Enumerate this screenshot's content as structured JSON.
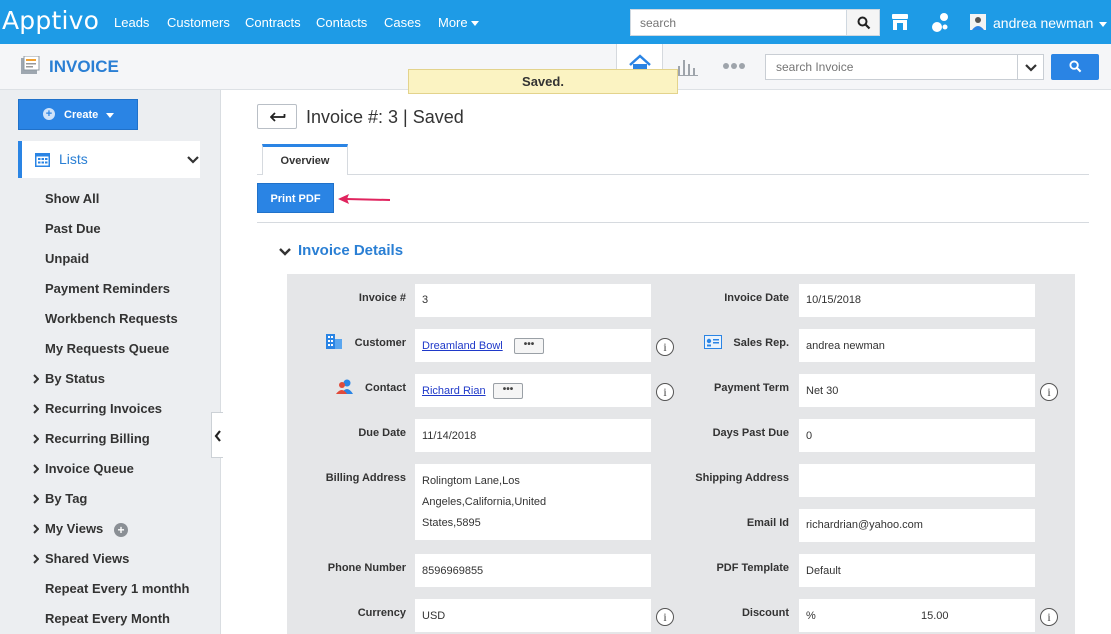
{
  "topnav": {
    "logo": "Apptivo",
    "links": [
      "Leads",
      "Customers",
      "Contracts",
      "Contacts",
      "Cases",
      "More"
    ],
    "search_placeholder": "search",
    "user_name": "andrea newman"
  },
  "subheader": {
    "app_title": "INVOICE",
    "saved_toast": "Saved.",
    "search_placeholder": "search Invoice"
  },
  "sidebar": {
    "create_label": "Create",
    "lists_label": "Lists",
    "items": [
      "Show All",
      "Past Due",
      "Unpaid",
      "Payment Reminders",
      "Workbench Requests",
      "My Requests Queue",
      "By Status",
      "Recurring Invoices",
      "Recurring Billing",
      "Invoice Queue",
      "By Tag",
      "My Views",
      "Shared Views",
      "Repeat Every 1 monthh",
      "Repeat Every Month"
    ]
  },
  "main": {
    "page_title": "Invoice #: 3 | Saved",
    "tab_overview": "Overview",
    "print_pdf": "Print PDF",
    "section_title": "Invoice Details",
    "fields": {
      "invoice_no": {
        "label": "Invoice #",
        "value": "3"
      },
      "invoice_date": {
        "label": "Invoice Date",
        "value": "10/15/2018"
      },
      "customer": {
        "label": "Customer",
        "value": "Dreamland Bowl"
      },
      "sales_rep": {
        "label": "Sales Rep.",
        "value": "andrea newman"
      },
      "contact": {
        "label": "Contact",
        "value": "Richard Rian"
      },
      "payment_term": {
        "label": "Payment Term",
        "value": "Net 30"
      },
      "due_date": {
        "label": "Due Date",
        "value": "11/14/2018"
      },
      "days_past_due": {
        "label": "Days Past Due",
        "value": "0"
      },
      "billing_address": {
        "label": "Billing Address",
        "line1": "Rolingtom Lane,Los",
        "line2": "Angeles,California,United",
        "line3": "States,5895"
      },
      "shipping_address": {
        "label": "Shipping Address",
        "value": ""
      },
      "email": {
        "label": "Email Id",
        "value": "richardrian@yahoo.com"
      },
      "phone": {
        "label": "Phone Number",
        "value": "8596969855"
      },
      "pdf_template": {
        "label": "PDF Template",
        "value": "Default"
      },
      "currency": {
        "label": "Currency",
        "value": "USD"
      },
      "discount": {
        "label": "Discount",
        "unit": "%",
        "value": "15.00"
      }
    },
    "more_glyph": "•••",
    "info_glyph": "i"
  },
  "colors": {
    "brand_blue": "#1e9be6",
    "button_blue": "#2a84e4",
    "link_blue": "#1f39c9",
    "toast_bg": "#fbf3c2",
    "arrow_red": "#e0245e"
  }
}
